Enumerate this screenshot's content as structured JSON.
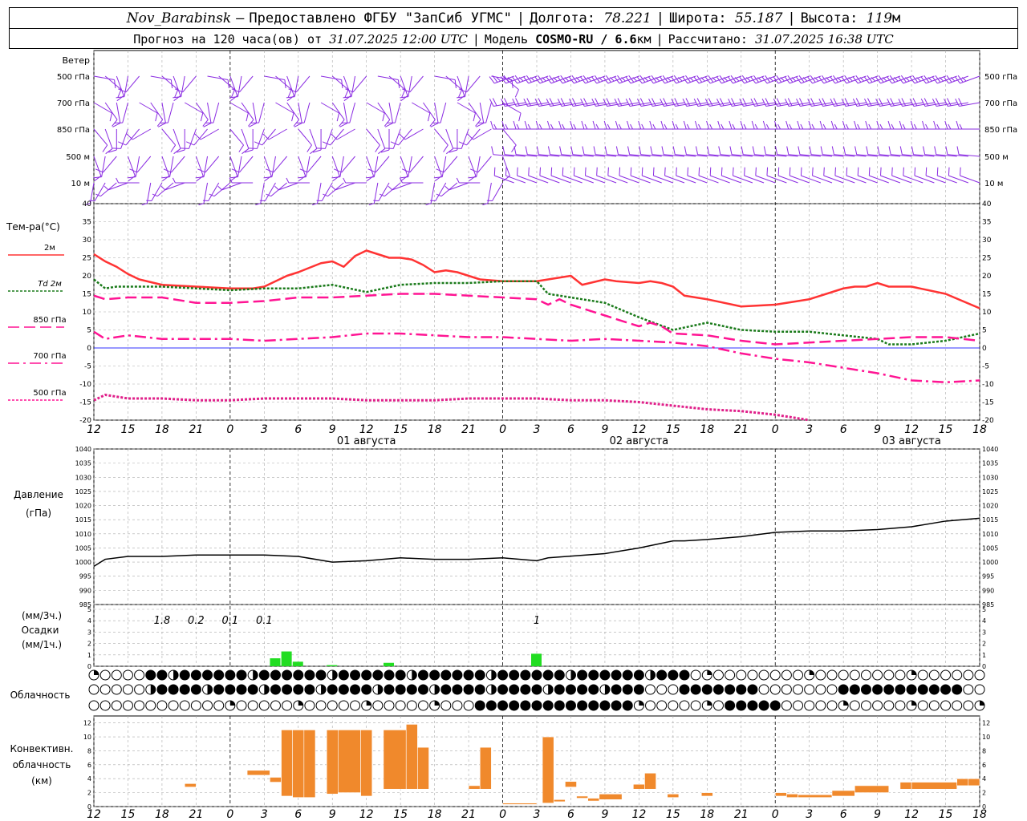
{
  "header": {
    "station": "Nov_Barabinsk",
    "dash": "—",
    "provider": "Предоставлено ФГБУ \"ЗапСиб УГМС\"",
    "lon_label": "Долгота:",
    "lon_value": "78.221",
    "lat_label": "Широта:",
    "lat_value": "55.187",
    "alt_label": "Высота:",
    "alt_value": "119",
    "alt_unit": "м",
    "forecast_prefix": "Прогноз на 120 часа(ов) от",
    "forecast_time": "31.07.2025 12:00 UTC",
    "model_label": "Модель",
    "model_name": "COSMO-RU / 6.6",
    "model_unit": "км",
    "calc_label": "Рассчитано:",
    "calc_time": "31.07.2025 16:38 UTC"
  },
  "wind_panel": {
    "title": "Ветер",
    "levels": [
      "500 гПа",
      "700 гПа",
      "850 гПа",
      "500 м",
      "10 м"
    ],
    "color": "#8a2be2"
  },
  "temperature_panel": {
    "title": "Тем-ра(°С)",
    "legend": [
      {
        "label": "2м",
        "color": "#ff3333",
        "style": "solid"
      },
      {
        "label": "Td  2м",
        "color": "#1a7a1a",
        "style": "dotted"
      },
      {
        "label": "850 гПа",
        "color": "#ff1493",
        "style": "dashed"
      },
      {
        "label": "700 гПа",
        "color": "#ff1493",
        "style": "dashdot"
      },
      {
        "label": "500 гПа",
        "color": "#ff1493",
        "style": "dotted"
      }
    ]
  },
  "pressure_panel": {
    "title1": "Давление",
    "title2": "(гПа)"
  },
  "precip_panel": {
    "label1": "(мм/3ч.)",
    "label2": "Осадки",
    "label3": "(мм/1ч.)",
    "totals": [
      {
        "hour": 6,
        "value": "1.8"
      },
      {
        "hour": 9,
        "value": "0.2"
      },
      {
        "hour": 12,
        "value": "0.1"
      },
      {
        "hour": 15,
        "value": "0.1"
      },
      {
        "hour": 39,
        "value": "1"
      }
    ]
  },
  "cloud_panel": {
    "title": "Облачность"
  },
  "conv_panel": {
    "label1": "Конвективн.",
    "label2": "облачность",
    "label3": "(км)"
  },
  "dates": [
    {
      "hour": 24,
      "label": "01 августа"
    },
    {
      "hour": 48,
      "label": "02 августа"
    },
    {
      "hour": 72,
      "label": "03 августа"
    }
  ],
  "chart_data": [
    {
      "type": "line",
      "title": "Тем-ра(°С)",
      "x_unit": "hours since 31.07.2025 12:00 UTC",
      "xlim": [
        0,
        78
      ],
      "x_ticks": [
        0,
        3,
        6,
        9,
        12,
        15,
        18,
        21,
        24,
        27,
        30,
        33,
        36,
        39,
        42,
        45,
        48,
        51,
        54,
        57,
        60,
        63,
        66,
        69,
        72,
        75,
        78
      ],
      "x_tick_labels": [
        "12",
        "15",
        "18",
        "21",
        "0",
        "3",
        "6",
        "9",
        "12",
        "15",
        "18",
        "21",
        "0",
        "3",
        "6",
        "9",
        "12",
        "15",
        "18",
        "21",
        "0",
        "3",
        "6",
        "9",
        "12",
        "15",
        "18"
      ],
      "ylim": [
        -20,
        40
      ],
      "y_ticks": [
        -20,
        -15,
        -10,
        -5,
        0,
        5,
        10,
        15,
        20,
        25,
        30,
        35,
        40
      ],
      "series": [
        {
          "name": "2м",
          "x": [
            0,
            1,
            2,
            3,
            4,
            6,
            9,
            12,
            14,
            15,
            17,
            18,
            20,
            21,
            22,
            23,
            24,
            25,
            26,
            27,
            28,
            29,
            30,
            31,
            32,
            34,
            36,
            38,
            39,
            40,
            41,
            42,
            43,
            45,
            46,
            48,
            49,
            50,
            51,
            52,
            54,
            57,
            60,
            63,
            66,
            67,
            68,
            69,
            70,
            72,
            75,
            78
          ],
          "y": [
            26,
            24,
            22.5,
            20.5,
            19,
            17.5,
            17,
            16.5,
            16.5,
            17,
            20,
            21,
            23.5,
            24,
            22.5,
            25.5,
            27,
            26,
            25,
            25,
            24.5,
            23,
            21,
            21.5,
            21,
            19,
            18.5,
            18.5,
            18.5,
            19,
            19.5,
            20,
            17.5,
            19,
            18.5,
            18,
            18.5,
            18,
            17,
            14.5,
            13.5,
            11.5,
            12,
            13.5,
            16.5,
            17,
            17,
            18,
            17,
            17,
            15,
            11
          ]
        },
        {
          "name": "Td 2м",
          "x": [
            0,
            1,
            2,
            3,
            6,
            9,
            12,
            15,
            18,
            21,
            24,
            27,
            30,
            33,
            36,
            39,
            40,
            42,
            45,
            48,
            51,
            54,
            57,
            60,
            63,
            66,
            69,
            70,
            71,
            72,
            75,
            78
          ],
          "y": [
            19,
            16.5,
            17,
            17,
            17,
            16.5,
            16,
            16.5,
            16.5,
            17.5,
            15.5,
            17.5,
            18,
            18,
            18.5,
            18.5,
            15,
            14,
            12.5,
            8.5,
            5,
            7,
            5,
            4.5,
            4.5,
            3.5,
            2.5,
            1,
            1,
            1,
            2,
            4
          ]
        },
        {
          "name": "850 гПа",
          "x": [
            0,
            1,
            3,
            6,
            9,
            12,
            15,
            18,
            21,
            24,
            27,
            30,
            33,
            36,
            39,
            40,
            41,
            42,
            45,
            48,
            49,
            50,
            51,
            54,
            57,
            60,
            63,
            66,
            69,
            72,
            75,
            78
          ],
          "y": [
            14.5,
            13.5,
            14,
            14,
            12.5,
            12.5,
            13,
            14,
            14,
            14.5,
            15,
            15,
            14.5,
            14,
            13.5,
            12,
            13.5,
            12,
            9,
            6,
            7,
            6,
            4,
            3.5,
            2,
            1,
            1.5,
            2,
            2.5,
            3,
            3,
            2
          ]
        },
        {
          "name": "700 гПа",
          "x": [
            0,
            1,
            3,
            6,
            9,
            12,
            15,
            18,
            21,
            24,
            27,
            30,
            33,
            36,
            39,
            42,
            45,
            48,
            51,
            54,
            57,
            60,
            63,
            66,
            69,
            72,
            75,
            78
          ],
          "y": [
            4.5,
            2.5,
            3.5,
            2.5,
            2.5,
            2.5,
            2,
            2.5,
            3,
            4,
            4,
            3.5,
            3,
            3,
            2.5,
            2,
            2.5,
            2,
            1.5,
            0.5,
            -1.5,
            -3,
            -4,
            -5.5,
            -7,
            -9,
            -9.5,
            -9
          ]
        },
        {
          "name": "500 гПа",
          "x": [
            0,
            1,
            2,
            3,
            6,
            9,
            12,
            15,
            18,
            21,
            24,
            27,
            30,
            33,
            36,
            39,
            42,
            45,
            48,
            51,
            54,
            57,
            60,
            62,
            63
          ],
          "y": [
            -14.5,
            -13,
            -13.5,
            -14,
            -14,
            -14.5,
            -14.5,
            -14,
            -14,
            -14,
            -14.5,
            -14.5,
            -14.5,
            -14,
            -14,
            -14,
            -14.5,
            -14.5,
            -15,
            -16,
            -17,
            -17.5,
            -18.5,
            -19.5,
            -20
          ]
        }
      ]
    },
    {
      "type": "line",
      "title": "Давление (гПа)",
      "x_unit": "hours since 31.07.2025 12:00 UTC",
      "xlim": [
        0,
        78
      ],
      "ylim": [
        985,
        1040
      ],
      "y_ticks": [
        985,
        990,
        995,
        1000,
        1005,
        1010,
        1015,
        1020,
        1025,
        1030,
        1035,
        1040
      ],
      "series": [
        {
          "name": "Давление",
          "x": [
            0,
            1,
            3,
            6,
            9,
            12,
            15,
            18,
            21,
            24,
            27,
            30,
            33,
            36,
            39,
            40,
            45,
            48,
            51,
            52,
            54,
            57,
            60,
            63,
            66,
            69,
            72,
            75,
            78
          ],
          "y": [
            998.5,
            1001,
            1002,
            1002,
            1002.5,
            1002.5,
            1002.5,
            1002,
            1000,
            1000.5,
            1001.5,
            1001,
            1001,
            1001.5,
            1000.5,
            1001.5,
            1003,
            1005,
            1007.5,
            1007.5,
            1008,
            1009,
            1010.5,
            1011,
            1011,
            1011.5,
            1012.5,
            1014.5,
            1015.5
          ]
        }
      ]
    },
    {
      "type": "bar",
      "title": "Осадки",
      "x_unit": "hours since 31.07.2025 12:00 UTC",
      "xlim": [
        0,
        78
      ],
      "ylim": [
        0,
        5
      ],
      "y_ticks": [
        0,
        1,
        2,
        3,
        4,
        5
      ],
      "x": [
        16,
        17,
        18,
        21,
        26,
        39
      ],
      "values": [
        0.7,
        1.3,
        0.4,
        0.1,
        0.3,
        1.1
      ]
    },
    {
      "type": "bar",
      "title": "Конвективн. облачность (км)",
      "x_unit": "hours since 31.07.2025 12:00 UTC",
      "xlim": [
        0,
        78
      ],
      "ylim": [
        0,
        13
      ],
      "y_ticks": [
        0,
        2,
        4,
        6,
        8,
        10,
        12
      ],
      "layers": [
        {
          "x0": 8,
          "x1": 9,
          "base": 2.8,
          "top": 3.3
        },
        {
          "x0": 13.5,
          "x1": 15.5,
          "base": 4.5,
          "top": 5.2
        },
        {
          "x0": 15.5,
          "x1": 16.5,
          "base": 3.5,
          "top": 4.2
        },
        {
          "x0": 16.5,
          "x1": 17.5,
          "base": 1.5,
          "top": 11
        },
        {
          "x0": 17.5,
          "x1": 18.5,
          "base": 1.3,
          "top": 11
        },
        {
          "x0": 18.5,
          "x1": 19.5,
          "base": 1.3,
          "top": 11
        },
        {
          "x0": 20.5,
          "x1": 21.5,
          "base": 1.8,
          "top": 11
        },
        {
          "x0": 21.5,
          "x1": 23.5,
          "base": 2,
          "top": 11
        },
        {
          "x0": 23.5,
          "x1": 24.5,
          "base": 1.5,
          "top": 11
        },
        {
          "x0": 25.5,
          "x1": 27.5,
          "base": 2.5,
          "top": 11
        },
        {
          "x0": 27.5,
          "x1": 28.5,
          "base": 2.5,
          "top": 11.8
        },
        {
          "x0": 28.5,
          "x1": 29.5,
          "base": 2.5,
          "top": 8.5
        },
        {
          "x0": 33,
          "x1": 34,
          "base": 2.5,
          "top": 3
        },
        {
          "x0": 34,
          "x1": 35,
          "base": 2.5,
          "top": 8.5
        },
        {
          "x0": 36,
          "x1": 39,
          "base": 0.3,
          "top": 0.5
        },
        {
          "x0": 39.5,
          "x1": 40.5,
          "base": 0.5,
          "top": 10
        },
        {
          "x0": 40.5,
          "x1": 41.5,
          "base": 0.7,
          "top": 1
        },
        {
          "x0": 41.5,
          "x1": 42.5,
          "base": 2.8,
          "top": 3.6
        },
        {
          "x0": 42.5,
          "x1": 43.5,
          "base": 1.2,
          "top": 1.5
        },
        {
          "x0": 43.5,
          "x1": 44.5,
          "base": 0.8,
          "top": 1.2
        },
        {
          "x0": 44.5,
          "x1": 46.5,
          "base": 1,
          "top": 1.8
        },
        {
          "x0": 47.5,
          "x1": 48.5,
          "base": 2.5,
          "top": 3.2
        },
        {
          "x0": 48.5,
          "x1": 49.5,
          "base": 2.5,
          "top": 4.8
        },
        {
          "x0": 50.5,
          "x1": 51.5,
          "base": 1.3,
          "top": 1.8
        },
        {
          "x0": 53.5,
          "x1": 54.5,
          "base": 1.5,
          "top": 2
        },
        {
          "x0": 60,
          "x1": 61,
          "base": 1.5,
          "top": 2
        },
        {
          "x0": 61,
          "x1": 62,
          "base": 1.3,
          "top": 1.8
        },
        {
          "x0": 62,
          "x1": 65,
          "base": 1.3,
          "top": 1.7
        },
        {
          "x0": 65,
          "x1": 67,
          "base": 1.5,
          "top": 2.3
        },
        {
          "x0": 67,
          "x1": 70,
          "base": 2,
          "top": 3
        },
        {
          "x0": 71,
          "x1": 72,
          "base": 2.5,
          "top": 3.5
        },
        {
          "x0": 72,
          "x1": 76,
          "base": 2.5,
          "top": 3.5
        },
        {
          "x0": 76,
          "x1": 77,
          "base": 3,
          "top": 4
        },
        {
          "x0": 77,
          "x1": 78,
          "base": 3,
          "top": 4
        }
      ]
    }
  ]
}
